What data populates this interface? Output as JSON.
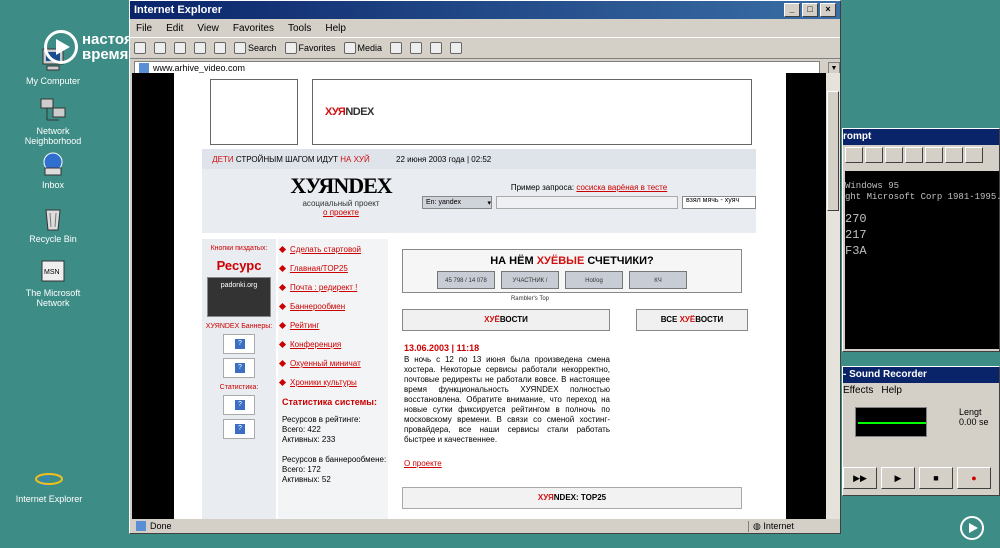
{
  "desktop": {
    "icons": [
      {
        "label": "My Computer",
        "icon": "computer-icon"
      },
      {
        "label": "Network Neighborhood",
        "icon": "network-icon"
      },
      {
        "label": "Inbox",
        "icon": "inbox-icon"
      },
      {
        "label": "Recycle Bin",
        "icon": "recycle-bin-icon"
      },
      {
        "label": "The Microsoft Network",
        "icon": "msn-icon"
      },
      {
        "label": "Internet Explorer",
        "icon": "ie-icon"
      }
    ],
    "channel_logo": [
      "настоящее",
      "время"
    ]
  },
  "browser": {
    "title": "Internet Explorer",
    "menu": [
      "File",
      "Edit",
      "View",
      "Favorites",
      "Tools",
      "Help"
    ],
    "toolbar": {
      "search": "Search",
      "favorites": "Favorites",
      "media": "Media"
    },
    "address": "www.arhive_video.com",
    "status": "Done",
    "zone": "Internet"
  },
  "site": {
    "small_logo": {
      "red": "ХУЯ",
      "black": "NDEX"
    },
    "slogan": {
      "red1": "ДЕТИ",
      "middle": "СТРОЙНЫМ ШАГОМ ИДУТ",
      "red2": "НА ХУЙ"
    },
    "date": "22 июня 2003 года | 02:52",
    "logo": {
      "word": "ХУЯNDEX",
      "subtitle": "асоциальный проект",
      "about": "о проекте"
    },
    "search": {
      "example_label": "Пример запроса:",
      "example_link": "сосиска варёная в тесте",
      "engine": "En: yandex",
      "button": "взял мячь - хуяч"
    },
    "left": {
      "buttons_title": "Кнопки пиздатых:",
      "resurs": "Ресурс",
      "padonki": "padonki.org",
      "banners_title": "ХУЯNDEX Баннеры:",
      "stats_title": "Статистика:",
      "q": "?"
    },
    "nav": [
      "Сделать стартовой",
      "Главная/TOP25",
      "Почта : редирект !",
      "Баннерообмен",
      "Рейтинг",
      "Конференция",
      "Охуенный миничат",
      "Хроники культуры"
    ],
    "stats": {
      "title": "Статистика системы:",
      "rating_label": "Ресурсов в рейтинге:",
      "rating_total": "Всего: 422",
      "rating_active": "Активных: 233",
      "exchange_label": "Ресурсов в баннерообмене:",
      "exchange_total": "Всего: 172",
      "exchange_active": "Активных: 52"
    },
    "counter_banner": {
      "pre": "НА НЁМ",
      "red": "ХУЁВЫЕ",
      "post": "СЧЕТЧИКИ?",
      "badges": [
        "45 798 / 14 078",
        "УЧАСТНИК / Rambler's Top",
        "Hot/og",
        "КЧ"
      ]
    },
    "news": {
      "header_pre": "ХУЁ",
      "header_post": "ВОСТИ",
      "all_pre": "ВСЕ ",
      "all_red": "ХУЁ",
      "all_post": "ВОСТИ",
      "date": "13.06.2003 | 11:18",
      "text": "В ночь с 12 по 13 июня была произведена смена хостера. Некоторые сервисы работали некорректно, почтовые редиректы не работали вовсе. В настоящее время функциональность ХУЯNDEX полностью восстановлена. Обратите внимание, что переход на новые сутки фиксируется рейтингом в полночь по московскому времени. В связи со сменой хостинг-провайдера, все наши сервисы стали работать быстрее и качественнее.",
      "more": "О проекте"
    },
    "top25": {
      "red": "ХУЯ",
      "post": "NDEX: TOP25"
    }
  },
  "cmd": {
    "title": "rompt",
    "lines": [
      "Windows 95",
      "ght Microsoft Corp 1981-1995."
    ],
    "big": [
      "270",
      "217",
      "F3A"
    ]
  },
  "sound": {
    "title": "- Sound Recorder",
    "menu": [
      "Effects",
      "Help"
    ],
    "length_label": "Lengt",
    "length_value": "0.00 se"
  },
  "colors": {
    "accent_red": "#d01010",
    "desktop": "#3d8c86",
    "title_blue": "#0a246a"
  }
}
